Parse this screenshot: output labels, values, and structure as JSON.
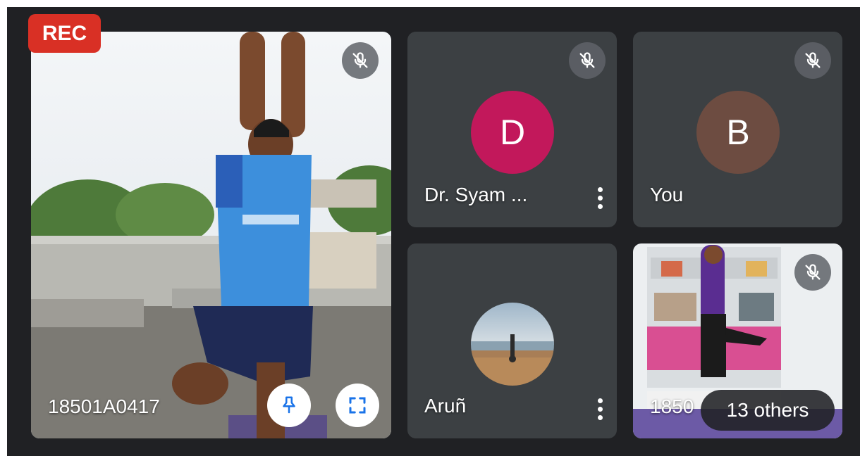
{
  "recording_badge": "REC",
  "participants": {
    "main": {
      "name": "18501A0417",
      "muted": true
    },
    "dr_syam": {
      "name": "Dr. Syam ...",
      "initial": "D",
      "avatar_color": "#c2185b",
      "muted": true
    },
    "you": {
      "name": "You",
      "initial": "B",
      "avatar_color": "#6d4c41",
      "muted": true
    },
    "arun": {
      "name": "Aruñ",
      "muted": false
    },
    "yoga_student": {
      "name": "1850",
      "muted": true
    }
  },
  "others_chip": "13 others",
  "icons": {
    "mute": "mic-off-icon",
    "pin": "pin-icon",
    "fullscreen": "fullscreen-icon",
    "more": "more-vert-icon"
  },
  "colors": {
    "background": "#202124",
    "tile": "#3c4043",
    "rec": "#d93025",
    "accent": "#1a73e8"
  }
}
